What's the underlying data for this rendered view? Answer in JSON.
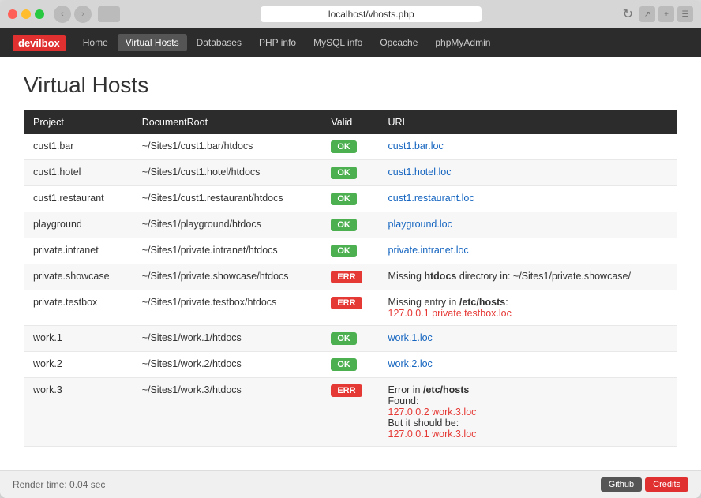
{
  "browser": {
    "address": "localhost/vhosts.php",
    "tab_label": "localhost/vhosts.php"
  },
  "nav": {
    "logo": "devilbox",
    "links": [
      "Home",
      "Virtual Hosts",
      "Databases",
      "PHP info",
      "MySQL info",
      "Opcache",
      "phpMyAdmin"
    ],
    "active": "Virtual Hosts"
  },
  "page": {
    "title": "Virtual Hosts",
    "table": {
      "headers": [
        "Project",
        "DocumentRoot",
        "Valid",
        "URL"
      ],
      "rows": [
        {
          "project": "cust1.bar",
          "docroot": "~/Sites1/cust1.bar/htdocs",
          "status": "OK",
          "status_type": "ok",
          "url": "cust1.bar.loc",
          "url_type": "link"
        },
        {
          "project": "cust1.hotel",
          "docroot": "~/Sites1/cust1.hotel/htdocs",
          "status": "OK",
          "status_type": "ok",
          "url": "cust1.hotel.loc",
          "url_type": "link"
        },
        {
          "project": "cust1.restaurant",
          "docroot": "~/Sites1/cust1.restaurant/htdocs",
          "status": "OK",
          "status_type": "ok",
          "url": "cust1.restaurant.loc",
          "url_type": "link"
        },
        {
          "project": "playground",
          "docroot": "~/Sites1/playground/htdocs",
          "status": "OK",
          "status_type": "ok",
          "url": "playground.loc",
          "url_type": "link"
        },
        {
          "project": "private.intranet",
          "docroot": "~/Sites1/private.intranet/htdocs",
          "status": "OK",
          "status_type": "ok",
          "url": "private.intranet.loc",
          "url_type": "link"
        },
        {
          "project": "private.showcase",
          "docroot": "~/Sites1/private.showcase/htdocs",
          "status": "ERR",
          "status_type": "err",
          "error_msg": "Missing htdocs directory in: ~/Sites1/private.showcase/",
          "error_bold": "htdocs",
          "url_type": "error"
        },
        {
          "project": "private.testbox",
          "docroot": "~/Sites1/private.testbox/htdocs",
          "status": "ERR",
          "status_type": "err",
          "error_msg": "Missing entry in /etc/hosts:",
          "error_bold": "/etc/hosts",
          "error_url": "127.0.0.1 private.testbox.loc",
          "url_type": "error_url"
        },
        {
          "project": "work.1",
          "docroot": "~/Sites1/work.1/htdocs",
          "status": "OK",
          "status_type": "ok",
          "url": "work.1.loc",
          "url_type": "link"
        },
        {
          "project": "work.2",
          "docroot": "~/Sites1/work.2/htdocs",
          "status": "OK",
          "status_type": "ok",
          "url": "work.2.loc",
          "url_type": "link"
        },
        {
          "project": "work.3",
          "docroot": "~/Sites1/work.3/htdocs",
          "status": "ERR",
          "status_type": "err",
          "error_msg_line1": "Error in /etc/hosts",
          "error_msg_line1_bold": "/etc/hosts",
          "error_msg_line2": "Found:",
          "error_url1": "127.0.0.2 work.3.loc",
          "error_msg_line3": "But it should be:",
          "error_url2": "127.0.0.1 work.3.loc",
          "url_type": "error_multi"
        }
      ]
    }
  },
  "footer": {
    "render_time": "Render time: 0.04 sec",
    "btn_github": "Github",
    "btn_credits": "Credits"
  }
}
